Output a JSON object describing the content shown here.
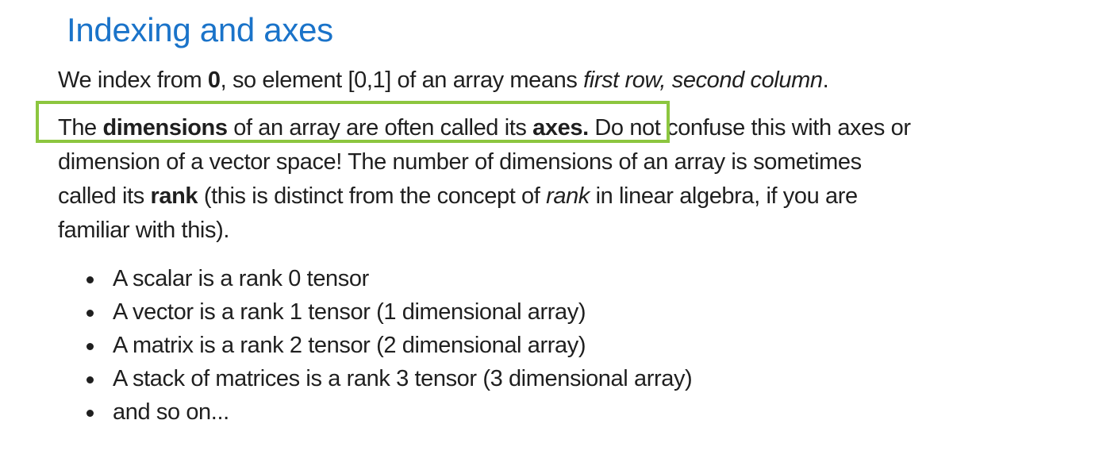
{
  "title": "Indexing and axes",
  "paragraph1": {
    "t1": "We index from ",
    "b1": "0",
    "t2": ", so element [0,1] of an array means ",
    "i1": "first row, second column",
    "t3": "."
  },
  "paragraph2": {
    "t1": "The ",
    "b1": "dimensions",
    "t2": " of an array are often called its ",
    "b2": "axes.",
    "t3": " Do not confuse this with axes or",
    "line2": "dimension of a vector space! The number of dimensions of an array is sometimes",
    "line3_t1": "called its ",
    "line3_b1": "rank",
    "line3_t2": " (this is distinct from the concept of ",
    "line3_i1": "rank",
    "line3_t3": " in linear algebra, if you are",
    "line4": "familiar with this)."
  },
  "bullets": [
    "A scalar is a rank 0 tensor",
    "A vector is a rank 1 tensor (1 dimensional array)",
    "A matrix is a rank 2 tensor (2 dimensional array)",
    "A stack of matrices is a rank 3 tensor (3 dimensional array)",
    "and so on..."
  ],
  "highlight_color": "#8cc63f",
  "title_color": "#1a73c9"
}
